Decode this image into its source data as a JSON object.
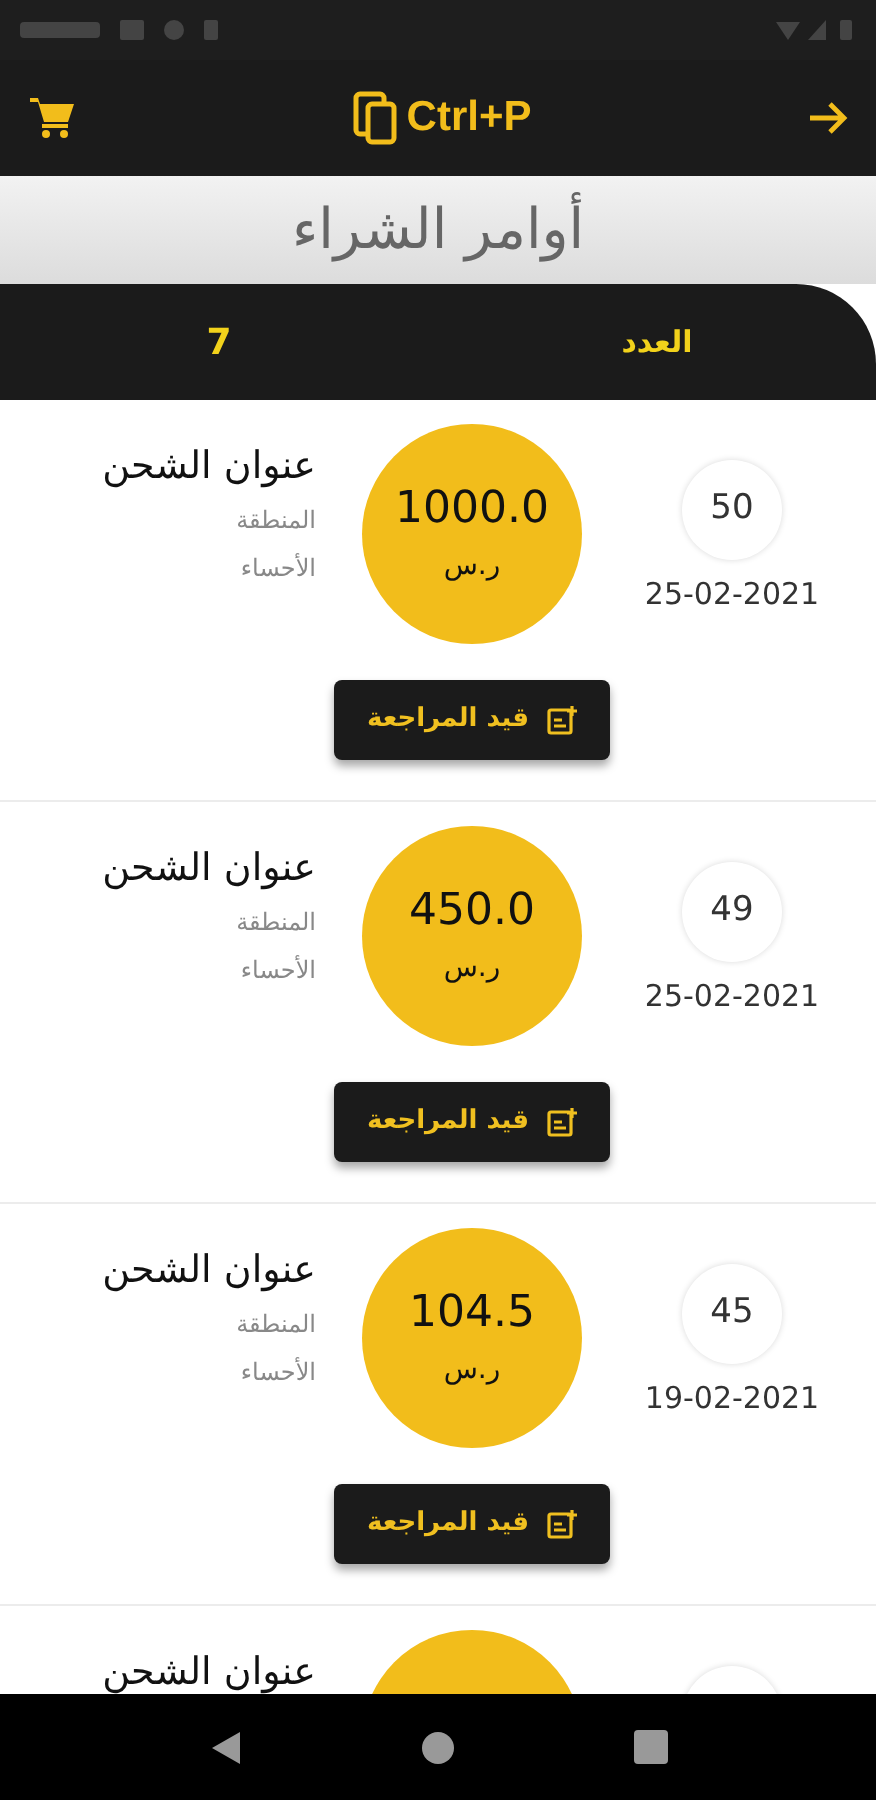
{
  "app_bar": {
    "logo_text": "Ctrl+P"
  },
  "page_title": "أوامر الشراء",
  "count": {
    "label": "العدد",
    "value": "7"
  },
  "orders": [
    {
      "kind": "order",
      "number": "50",
      "date": "25-02-2021",
      "amount": "1000.0",
      "currency": "ر.س",
      "title": "عنوان الشحن",
      "region_label": "المنطقة",
      "region": "الأحساء",
      "action": "قيد المراجعة"
    },
    {
      "kind": "order",
      "number": "49",
      "date": "25-02-2021",
      "amount": "450.0",
      "currency": "ر.س",
      "title": "عنوان الشحن",
      "region_label": "المنطقة",
      "region": "الأحساء",
      "action": "قيد المراجعة"
    },
    {
      "kind": "order",
      "number": "45",
      "date": "19-02-2021",
      "amount": "104.5",
      "currency": "ر.س",
      "title": "عنوان الشحن",
      "region_label": "المنطقة",
      "region": "الأحساء",
      "action": "قيد المراجعة"
    },
    {
      "kind": "partial",
      "title": "عنوان الشحن"
    }
  ]
}
